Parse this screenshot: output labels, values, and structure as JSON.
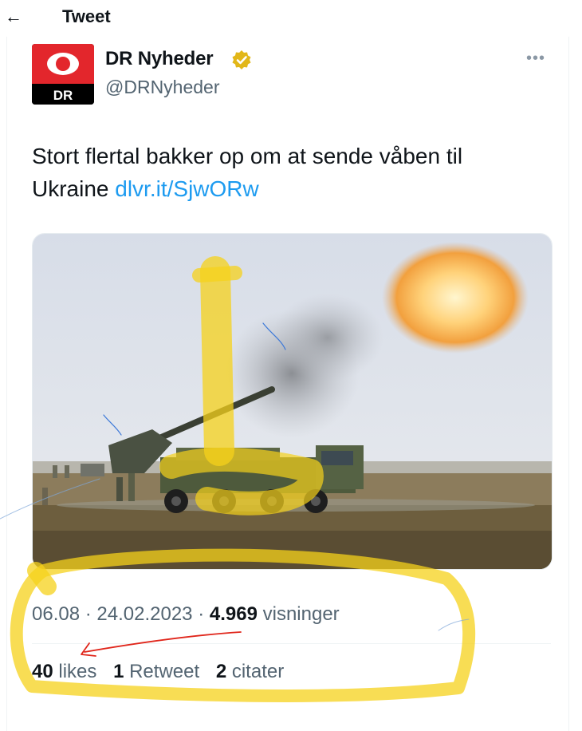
{
  "header": {
    "back_icon": "back-arrow-icon",
    "title": "Tweet"
  },
  "author": {
    "name": "DR Nyheder",
    "handle": "@DRNyheder",
    "avatar_logo_text": "DR",
    "verified_icon": "verified-badge-icon",
    "verified_color": "#e2b719",
    "more_icon": "more-options-icon"
  },
  "tweet": {
    "text": "Stort flertal bakker op om at sende våben til Ukraine ",
    "link": "dlvr.it/SjwORw",
    "link_color": "#1d9bf0",
    "media_description_icon": "artillery-photo"
  },
  "meta": {
    "time": "06.08",
    "separator": "·",
    "date": "24.02.2023",
    "views_count": "4.969",
    "views_label": "visninger"
  },
  "stats": {
    "likes_count": "40",
    "likes_label": "likes",
    "retweets_count": "1",
    "retweets_label": "Retweet",
    "quotes_count": "2",
    "quotes_label": "citater"
  },
  "annotations": {
    "highlighter_color": "#f5d21b",
    "pen_red": "#e0261b",
    "pen_blue": "#3c78d8"
  }
}
